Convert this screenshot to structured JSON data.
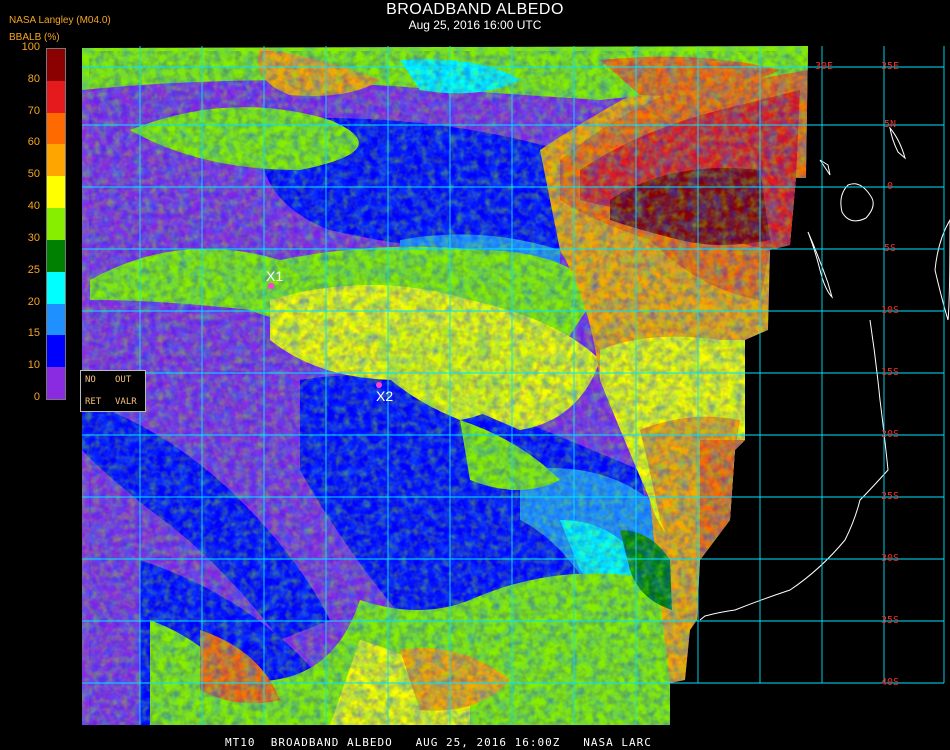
{
  "header": {
    "title": "BROADBAND ALBEDO",
    "subtitle": "Aug 25, 2016 16:00 UTC",
    "source": "NASA Langley (M04.0)"
  },
  "colorbar": {
    "label": "BBALB (%)",
    "ticks": [
      "100",
      "80",
      "70",
      "60",
      "50",
      "40",
      "30",
      "25",
      "20",
      "15",
      "10",
      "0"
    ],
    "colors": [
      "#8b0000",
      "#e41a1c",
      "#ff6a00",
      "#ffa500",
      "#ffff00",
      "#88ee00",
      "#008000",
      "#00ffff",
      "#1e90ff",
      "#0000ff",
      "#8a2be2"
    ],
    "ranges": [
      [
        80,
        100
      ],
      [
        70,
        80
      ],
      [
        60,
        70
      ],
      [
        50,
        60
      ],
      [
        40,
        50
      ],
      [
        30,
        40
      ],
      [
        25,
        30
      ],
      [
        20,
        25
      ],
      [
        15,
        20
      ],
      [
        10,
        15
      ],
      [
        0,
        10
      ]
    ]
  },
  "legend_box": {
    "no": "NO",
    "out": "OUT",
    "ret": "RET",
    "valr": "VALR"
  },
  "grid": {
    "lat_labels": [
      "35E",
      "5N",
      "0",
      "5S",
      "10S",
      "15S",
      "20S",
      "25S",
      "30S",
      "35S",
      "40S"
    ],
    "lon_labels": [
      "30E"
    ],
    "color": "#00e5ff",
    "label_color": "#e8322b"
  },
  "markers": [
    {
      "label": "X1"
    },
    {
      "label": "X2"
    }
  ],
  "footer": "MT10  BROADBAND ALBEDO   AUG 25, 2016 16:00Z   NASA LARC"
}
